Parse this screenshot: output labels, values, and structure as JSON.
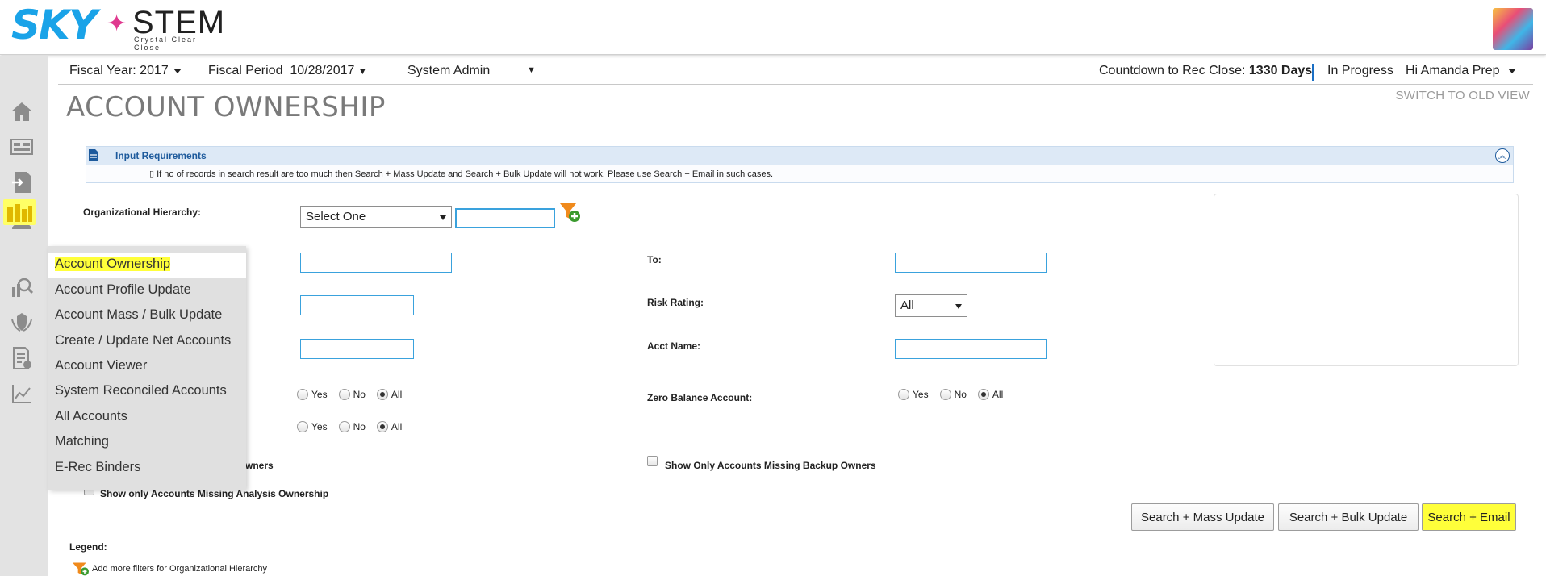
{
  "brand": {
    "logo_left": "SKY",
    "logo_right": "STEM",
    "tagline": "Crystal Clear Close"
  },
  "topbar": {
    "fiscal_year_label": "Fiscal Year:",
    "fiscal_year_value": "2017",
    "fiscal_period_label": "Fiscal Period",
    "fiscal_period_value": "10/28/2017",
    "role": "System Admin",
    "countdown_label": "Countdown to Rec Close:",
    "countdown_value": "1330 Days",
    "status": "In Progress",
    "greeting": "Hi Amanda Prep"
  },
  "page": {
    "title": "ACCOUNT OWNERSHIP",
    "switch_view": "SWITCH TO OLD VIEW"
  },
  "requirements": {
    "title": "Input Requirements",
    "message": "▯ If no of records in search result are too much then Search + Mass Update and Search + Bulk Update will not work. Please use Search + Email in such cases."
  },
  "form": {
    "org_hierarchy_label": "Organizational Hierarchy:",
    "org_select_value": "Select One",
    "to_label": "To:",
    "risk_rating_label": "Risk Rating:",
    "risk_rating_value": "All",
    "acct_name_label": "Acct Name:",
    "zero_balance_label": "Zero Balance Account:",
    "radio_yes": "Yes",
    "radio_no": "No",
    "radio_all": "All",
    "missing_owners_partial": "wners",
    "missing_backup_label": "Show Only Accounts Missing Backup Owners",
    "missing_analysis_label": "Show only Accounts Missing Analysis Ownership"
  },
  "buttons": {
    "mass_update": "Search + Mass Update",
    "bulk_update": "Search + Bulk Update",
    "email": "Search + Email"
  },
  "legend": {
    "title": "Legend:",
    "item": "Add more filters for Organizational Hierarchy"
  },
  "menu": {
    "items": [
      "Account Ownership",
      "Account Profile Update",
      "Account Mass / Bulk Update",
      "Create / Update Net Accounts",
      "Account Viewer",
      "System Reconciled Accounts",
      "All Accounts",
      "Matching",
      "E-Rec Binders"
    ]
  },
  "colors": {
    "highlight": "#ffff3a",
    "brand_blue": "#1aa3e8",
    "panel_blue": "#1d5a9c"
  }
}
